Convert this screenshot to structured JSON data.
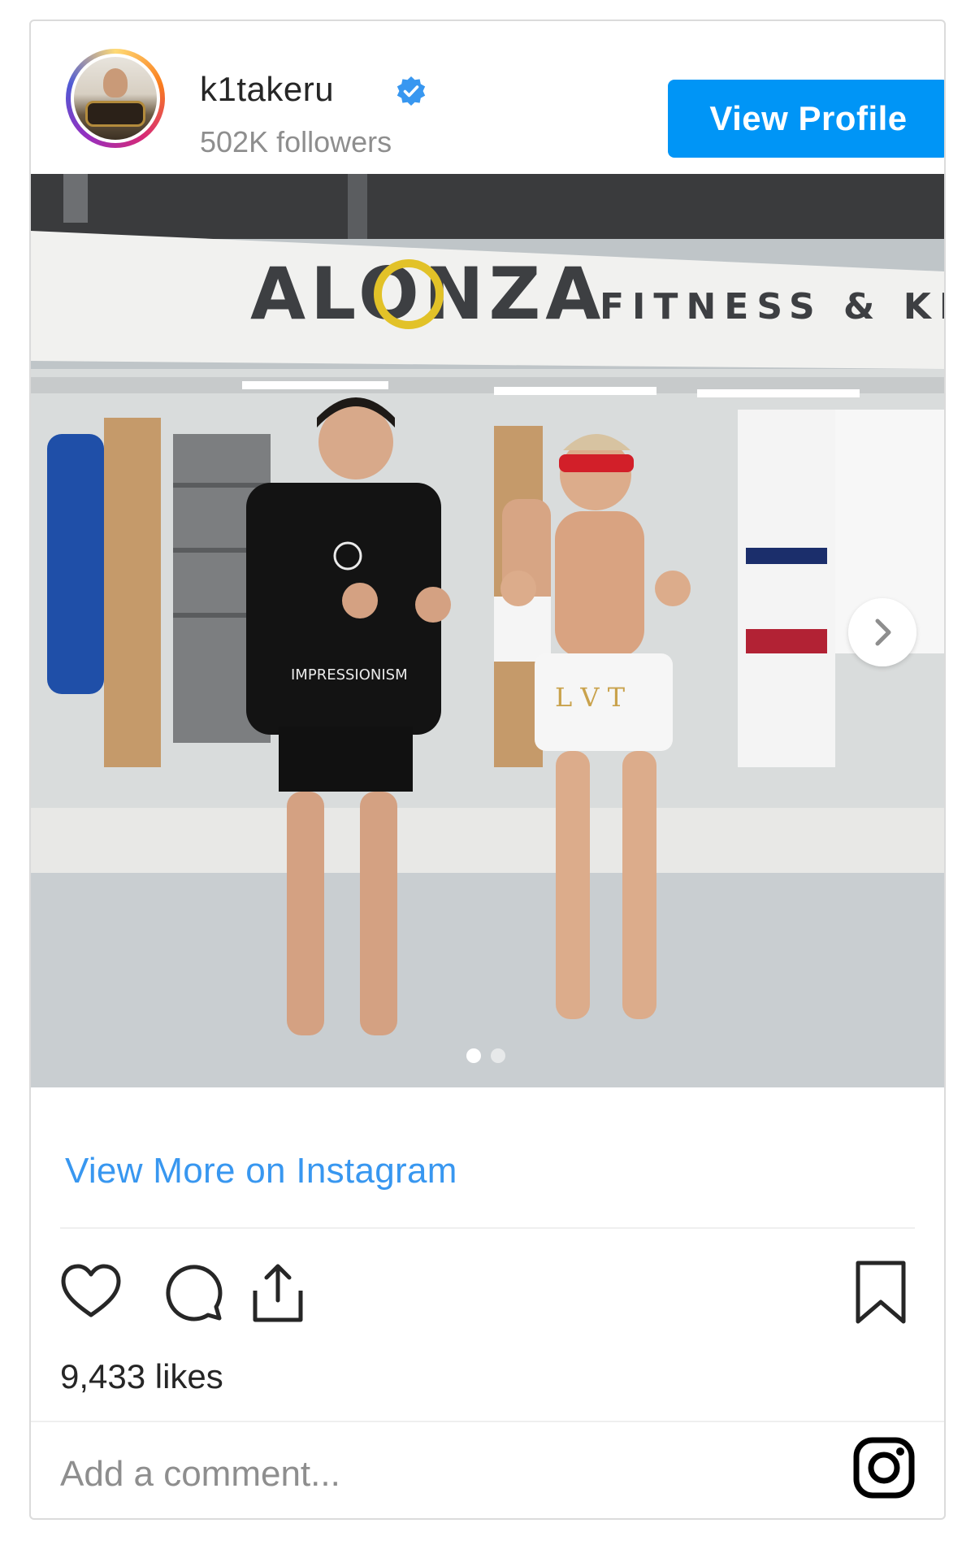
{
  "header": {
    "username": "k1takeru",
    "followers": "502K followers",
    "view_profile_label": "View Profile",
    "verified_badge": "verified-icon"
  },
  "post": {
    "carousel": {
      "current_index": 1,
      "total": 2
    },
    "sign_text_1": "ALONZA",
    "sign_text_2": "FITNESS & KI",
    "shirt_text": "IMPRESSIONISM"
  },
  "caption": {
    "view_more_label": "View More on Instagram"
  },
  "actions": {
    "icons": [
      "heart-icon",
      "comment-icon",
      "share-icon",
      "bookmark-icon"
    ]
  },
  "likes": "9,433 likes",
  "comment": {
    "placeholder": "Add a comment...",
    "value": ""
  },
  "colors": {
    "primary_button": "#0095f6",
    "link": "#3897f0",
    "secondary_text": "#8e8e8e",
    "border": "#dbdbdb"
  }
}
